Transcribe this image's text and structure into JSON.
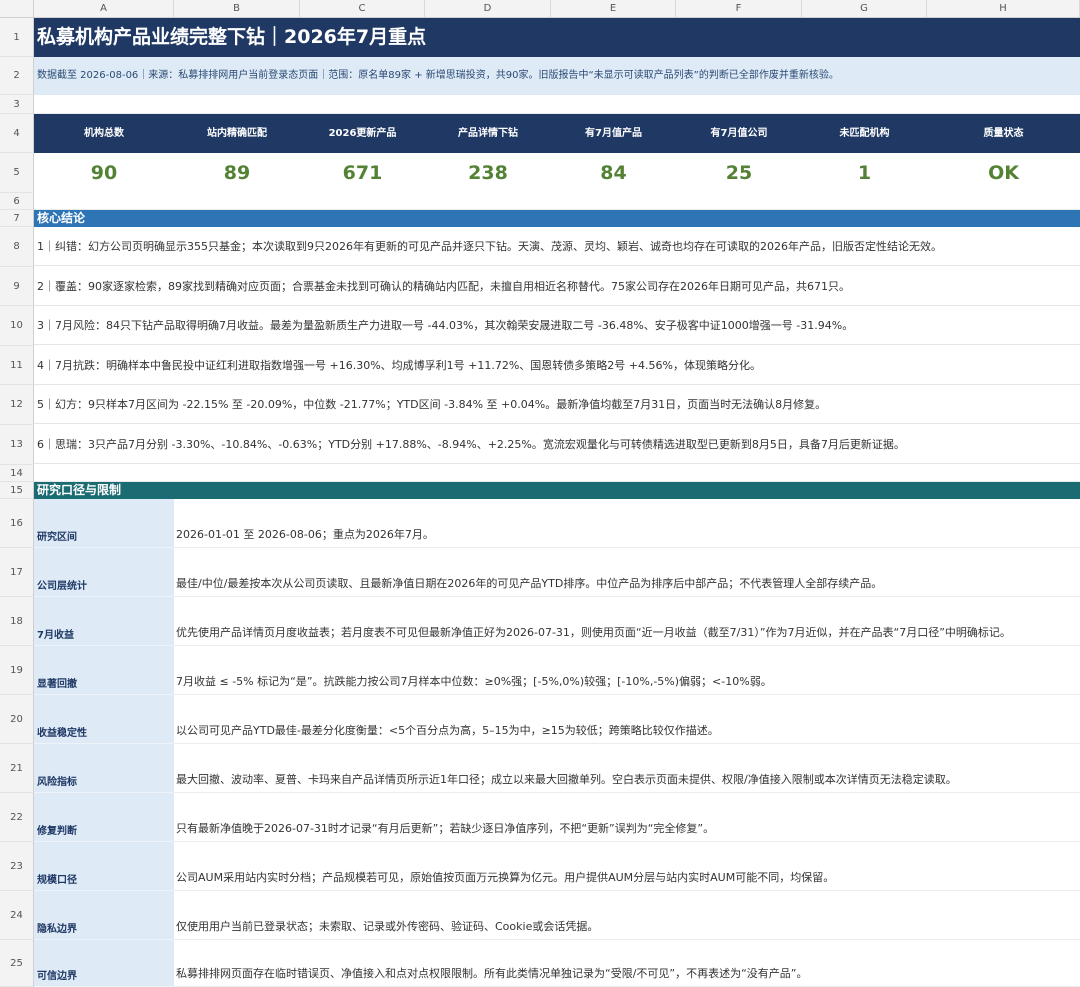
{
  "columns": [
    "A",
    "B",
    "C",
    "D",
    "E",
    "F",
    "G",
    "H"
  ],
  "rows": [
    "1",
    "2",
    "3",
    "4",
    "5",
    "6",
    "7",
    "8",
    "9",
    "10",
    "11",
    "12",
    "13",
    "14",
    "15",
    "16",
    "17",
    "18",
    "19",
    "20",
    "21",
    "22",
    "23",
    "24",
    "25"
  ],
  "title": "私募机构产品业绩完整下钻｜2026年7月重点",
  "source": "数据截至 2026-08-06｜来源：私募排排网用户当前登录态页面｜范围：原名单89家 + 新增思瑞投资，共90家。旧版报告中“未显示可读取产品列表”的判断已全部作废并重新核验。",
  "kpis": [
    {
      "label": "机构总数",
      "value": "90"
    },
    {
      "label": "站内精确匹配",
      "value": "89"
    },
    {
      "label": "2026更新产品",
      "value": "671"
    },
    {
      "label": "产品详情下钻",
      "value": "238"
    },
    {
      "label": "有7月值产品",
      "value": "84"
    },
    {
      "label": "有7月值公司",
      "value": "25"
    },
    {
      "label": "未匹配机构",
      "value": "1"
    },
    {
      "label": "质量状态",
      "value": "OK"
    }
  ],
  "section_conclusions": "核心结论",
  "conclusions": [
    "1｜纠错：幻方公司页明确显示355只基金；本次读取到9只2026年有更新的可见产品并逐只下钻。天演、茂源、灵均、颖岩、诚奇也均存在可读取的2026年产品，旧版否定性结论无效。",
    "2｜覆盖：90家逐家检索，89家找到精确对应页面；合票基金未找到可确认的精确站内匹配，未擅自用相近名称替代。75家公司存在2026年日期可见产品，共671只。",
    "3｜7月风险：84只下钻产品取得明确7月收益。最差为量盈新质生产力进取一号 -44.03%，其次翰荣安晟进取二号 -36.48%、安子极客中证1000增强一号 -31.94%。",
    "4｜7月抗跌：明确样本中鲁民投中证红利进取指数增强一号 +16.30%、均成博孚利1号 +11.72%、国恩转债多策略2号 +4.56%，体现策略分化。",
    "5｜幻方：9只样本7月区间为 -22.15% 至 -20.09%，中位数 -21.77%；YTD区间 -3.84% 至 +0.04%。最新净值均截至7月31日，页面当时无法确认8月修复。",
    "6｜思瑞：3只产品7月分别 -3.30%、-10.84%、-0.63%；YTD分别 +17.88%、-8.94%、+2.25%。宽流宏观量化与可转债精选进取型已更新到8月5日，具备7月后更新证据。"
  ],
  "section_limits": "研究口径与限制",
  "limits": [
    {
      "label": "研究区间",
      "text": "2026-01-01 至 2026-08-06；重点为2026年7月。"
    },
    {
      "label": "公司层统计",
      "text": "最佳/中位/最差按本次从公司页读取、且最新净值日期在2026年的可见产品YTD排序。中位产品为排序后中部产品；不代表管理人全部存续产品。"
    },
    {
      "label": "7月收益",
      "text": "优先使用产品详情页月度收益表；若月度表不可见但最新净值正好为2026-07-31，则使用页面“近一月收益（截至7/31）”作为7月近似，并在产品表“7月口径”中明确标记。"
    },
    {
      "label": "显著回撤",
      "text": "7月收益 ≤ -5% 标记为“是”。抗跌能力按公司7月样本中位数：≥0%强；[-5%,0%)较强；[-10%,-5%)偏弱；<-10%弱。"
    },
    {
      "label": "收益稳定性",
      "text": "以公司可见产品YTD最佳-最差分化度衡量：<5个百分点为高，5–15为中，≥15为较低；跨策略比较仅作描述。"
    },
    {
      "label": "风险指标",
      "text": "最大回撤、波动率、夏普、卡玛来自产品详情页所示近1年口径；成立以来最大回撤单列。空白表示页面未提供、权限/净值接入限制或本次详情页无法稳定读取。"
    },
    {
      "label": "修复判断",
      "text": "只有最新净值晚于2026-07-31时才记录“有月后更新”；若缺少逐日净值序列，不把“更新”误判为“完全修复”。"
    },
    {
      "label": "规模口径",
      "text": "公司AUM采用站内实时分档；产品规模若可见，原始值按页面万元换算为亿元。用户提供AUM分层与站内实时AUM可能不同，均保留。"
    },
    {
      "label": "隐私边界",
      "text": "仅使用用户当前已登录状态；未索取、记录或外传密码、验证码、Cookie或会话凭据。"
    },
    {
      "label": "可信边界",
      "text": "私募排排网页面存在临时错误页、净值接入和点对点权限限制。所有此类情况单独记录为“受限/不可见”，不再表述为“没有产品”。"
    }
  ],
  "colors": {
    "navy": "#1f3864",
    "lightblue": "#deebf7",
    "green": "#548235",
    "blue": "#2e75b6",
    "teal": "#1b6b73"
  }
}
